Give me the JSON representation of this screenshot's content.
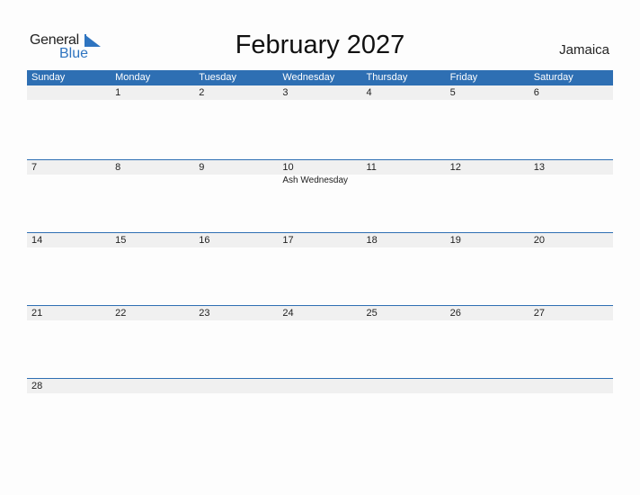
{
  "logo": {
    "line1": "General",
    "line2": "Blue",
    "accent": "#2e74c0"
  },
  "title": "February 2027",
  "country": "Jamaica",
  "weekdays": [
    "Sunday",
    "Monday",
    "Tuesday",
    "Wednesday",
    "Thursday",
    "Friday",
    "Saturday"
  ],
  "weeks": [
    {
      "days": [
        "",
        "1",
        "2",
        "3",
        "4",
        "5",
        "6"
      ],
      "events": [
        "",
        "",
        "",
        "",
        "",
        "",
        ""
      ]
    },
    {
      "days": [
        "7",
        "8",
        "9",
        "10",
        "11",
        "12",
        "13"
      ],
      "events": [
        "",
        "",
        "",
        "Ash Wednesday",
        "",
        "",
        ""
      ]
    },
    {
      "days": [
        "14",
        "15",
        "16",
        "17",
        "18",
        "19",
        "20"
      ],
      "events": [
        "",
        "",
        "",
        "",
        "",
        "",
        ""
      ]
    },
    {
      "days": [
        "21",
        "22",
        "23",
        "24",
        "25",
        "26",
        "27"
      ],
      "events": [
        "",
        "",
        "",
        "",
        "",
        "",
        ""
      ]
    },
    {
      "days": [
        "28",
        "",
        "",
        "",
        "",
        "",
        ""
      ],
      "events": [
        "",
        "",
        "",
        "",
        "",
        "",
        ""
      ]
    }
  ]
}
